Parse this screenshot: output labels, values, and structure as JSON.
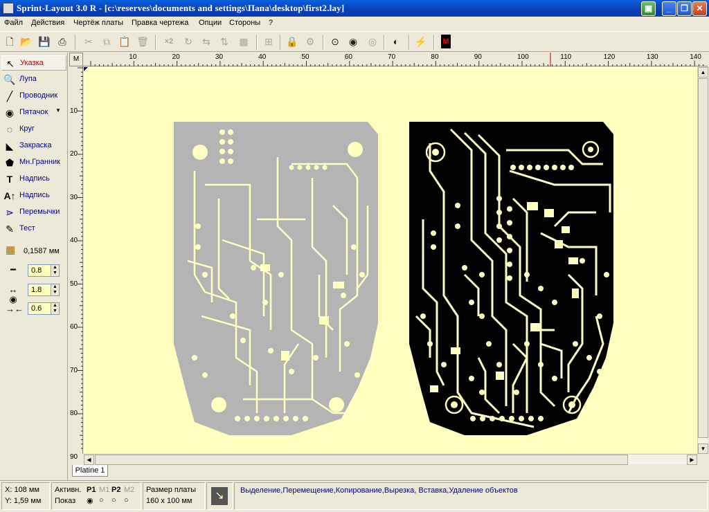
{
  "window": {
    "title": "Sprint-Layout 3.0 R - [c:\\reserves\\documents and settings\\Папа\\desktop\\first2.lay]"
  },
  "menu": [
    "Файл",
    "Действия",
    "Чертёж платы",
    "Правка чертежа",
    "Опции",
    "Стороны",
    "?"
  ],
  "tools": [
    {
      "label": "Указка",
      "icon": "pointer-icon",
      "selected": true
    },
    {
      "label": "Лупа",
      "icon": "magnifier-icon"
    },
    {
      "label": "Проводник",
      "icon": "track-icon"
    },
    {
      "label": "Пятачок",
      "icon": "pad-icon"
    },
    {
      "label": "Круг",
      "icon": "circle-icon"
    },
    {
      "label": "Закраска",
      "icon": "fill-icon"
    },
    {
      "label": "Мн.Гранник",
      "icon": "polygon-icon"
    },
    {
      "label": "Надпись",
      "icon": "text-icon"
    },
    {
      "label": "Надпись",
      "icon": "text-sub-icon"
    },
    {
      "label": "Перемычки",
      "icon": "jumper-icon"
    },
    {
      "label": "Тест",
      "icon": "test-icon"
    }
  ],
  "grid": {
    "value": "0,1587 мм"
  },
  "track_width": {
    "value": "0.8"
  },
  "pad_outer": {
    "value": "1.8"
  },
  "pad_inner": {
    "value": "0.6"
  },
  "ruler": {
    "corner": "M",
    "h_ticks": [
      "10",
      "20",
      "30",
      "40",
      "50",
      "60",
      "70",
      "80",
      "90",
      "100",
      "110",
      "120",
      "130",
      "140"
    ],
    "v_ticks": [
      "10",
      "20",
      "30",
      "40",
      "50",
      "60",
      "70",
      "80",
      "90"
    ]
  },
  "tab": {
    "label": "Platine 1"
  },
  "status": {
    "x": "X: 108 мм",
    "y": "Y: 1,59 мм",
    "active_label": "Активн.",
    "show_label": "Показ",
    "p1": "P1",
    "m1": "M1",
    "p2": "P2",
    "m2": "M2",
    "board_size_label": "Размер платы",
    "board_size": "160 x 100 мм",
    "hint": "Выделение,Перемещение,Копирование,Вырезка, Вставка,Удаление объектов"
  },
  "colors": {
    "canvas": "#ffffc0",
    "bottom_layer": "#b4b4b4",
    "top_layer": "#000000",
    "title_bar": "#0a4fd0"
  }
}
